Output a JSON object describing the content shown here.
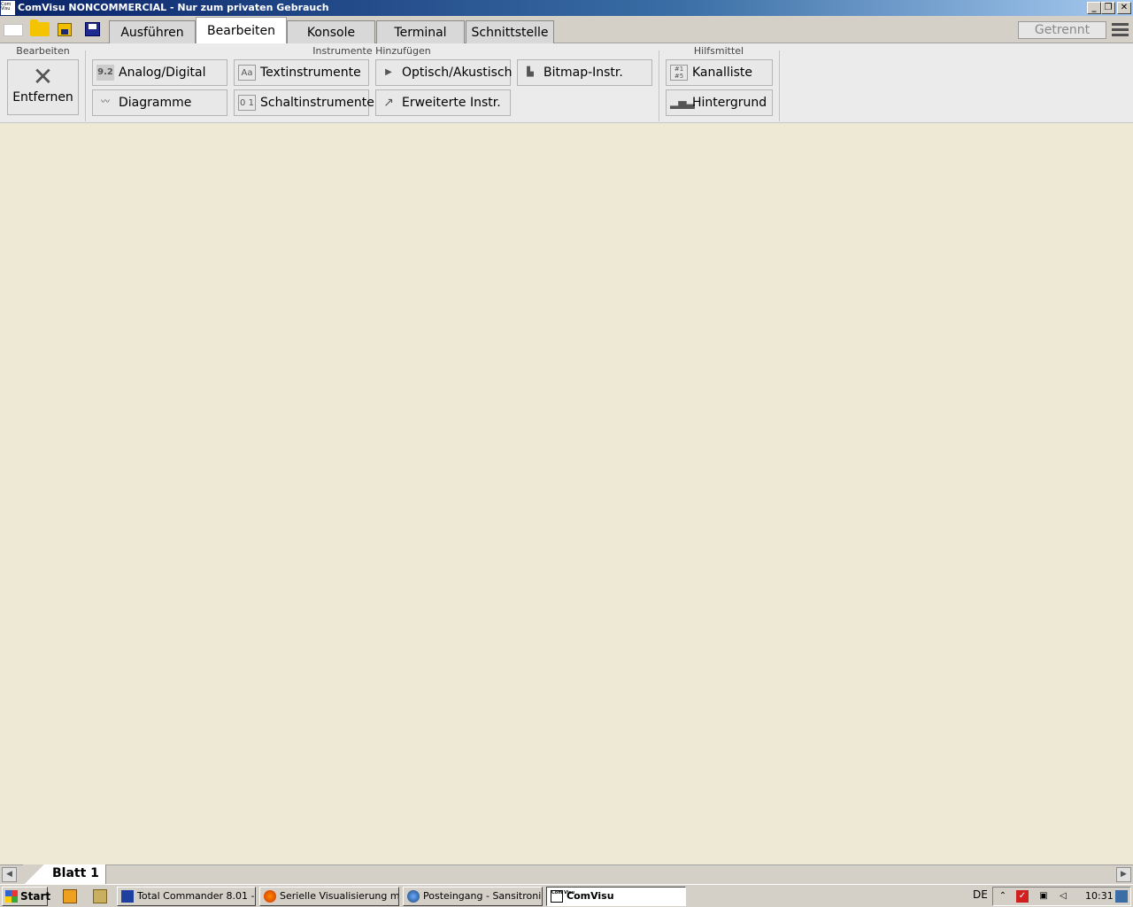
{
  "window": {
    "title": "ComVisu NONCOMMERCIAL - Nur zum privaten Gebrauch",
    "icon_text": "Com Visu",
    "controls": [
      "minimize-icon",
      "restore-icon",
      "close-icon"
    ]
  },
  "quick_access": [
    "new-file-icon",
    "open-folder-icon",
    "save-as-icon",
    "save-icon"
  ],
  "tabs": [
    {
      "label": "Ausführen"
    },
    {
      "label": "Bearbeiten",
      "active": true
    },
    {
      "label": "Konsole"
    },
    {
      "label": "Terminal"
    },
    {
      "label": "Schnittstelle"
    }
  ],
  "connection_status": "Getrennt",
  "ribbon": {
    "groups": {
      "edit": "Bearbeiten",
      "instruments": "Instrumente Hinzufügen",
      "tools": "Hilfsmittel"
    },
    "remove": "Entfernen",
    "buttons": {
      "analog": "Analog/Digital",
      "analog_icon": "9.2",
      "text": "Textinstrumente",
      "text_icon": "Aa",
      "optical": "Optisch/Akustisch",
      "bitmap": "Bitmap-Instr.",
      "diagrams": "Diagramme",
      "switch": "Schaltinstrumente",
      "switch_icon": "0 1",
      "extended": "Erweiterte Instr.",
      "channels": "Kanalliste",
      "background": "Hintergrund"
    }
  },
  "canvas_color": "#ede9d4",
  "sheet": {
    "tab": "Blatt 1"
  },
  "taskbar": {
    "start": "Start",
    "tasks": [
      {
        "label": "Total Commander 8.01 - ..."
      },
      {
        "label": "Serielle Visualisierung mit..."
      },
      {
        "label": "Posteingang - Sansitroni..."
      },
      {
        "label": "ComVisu",
        "active": true
      }
    ],
    "language": "DE",
    "clock": "10:31"
  }
}
